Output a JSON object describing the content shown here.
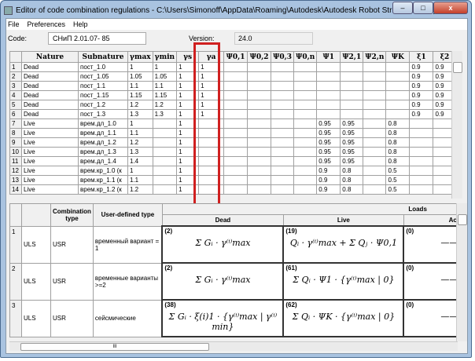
{
  "window": {
    "title": "Editor of code combination regulations - C:\\Users\\Simonoff\\AppData\\Roaming\\Autodesk\\Autodesk Robot Structural Analys...",
    "minimize": "–",
    "maximize": "□",
    "close": "x"
  },
  "menu": [
    "File",
    "Preferences",
    "Help"
  ],
  "code": {
    "label": "Code:",
    "value": "СНиП 2.01.07- 85"
  },
  "version": {
    "label": "Version:",
    "value": "24.0"
  },
  "top_table": {
    "headers": [
      "",
      "Nature",
      "Subnature",
      "γmax",
      "γmin",
      "γs",
      "γa",
      "Ψ0,1",
      "Ψ0,2",
      "Ψ0,3",
      "Ψ0,n",
      "Ψ1",
      "Ψ2,1",
      "Ψ2,n",
      "ΨK",
      "ξ1",
      "ξ2"
    ],
    "rows": [
      [
        "1",
        "Dead",
        "пост_1.0",
        "1",
        "1",
        "1",
        "1",
        "",
        "",
        "",
        "",
        "",
        "",
        "",
        "",
        "0.9",
        "0.9"
      ],
      [
        "2",
        "Dead",
        "пост_1.05",
        "1.05",
        "1.05",
        "1",
        "1",
        "",
        "",
        "",
        "",
        "",
        "",
        "",
        "",
        "0.9",
        "0.9"
      ],
      [
        "3",
        "Dead",
        "пост_1.1",
        "1.1",
        "1.1",
        "1",
        "1",
        "",
        "",
        "",
        "",
        "",
        "",
        "",
        "",
        "0.9",
        "0.9"
      ],
      [
        "4",
        "Dead",
        "пост_1.15",
        "1.15",
        "1.15",
        "1",
        "1",
        "",
        "",
        "",
        "",
        "",
        "",
        "",
        "",
        "0.9",
        "0.9"
      ],
      [
        "5",
        "Dead",
        "пост_1.2",
        "1.2",
        "1.2",
        "1",
        "1",
        "",
        "",
        "",
        "",
        "",
        "",
        "",
        "",
        "0.9",
        "0.9"
      ],
      [
        "6",
        "Dead",
        "пост_1.3",
        "1.3",
        "1.3",
        "1",
        "1",
        "",
        "",
        "",
        "",
        "",
        "",
        "",
        "",
        "0.9",
        "0.9"
      ],
      [
        "7",
        "Live",
        "врем.дл_1.0",
        "1",
        "",
        "1",
        "",
        "",
        "",
        "",
        "",
        "0.95",
        "0.95",
        "",
        "0.8",
        "",
        ""
      ],
      [
        "8",
        "Live",
        "врем.дл_1.1",
        "1.1",
        "",
        "1",
        "",
        "",
        "",
        "",
        "",
        "0.95",
        "0.95",
        "",
        "0.8",
        "",
        ""
      ],
      [
        "9",
        "Live",
        "врем.дл_1.2",
        "1.2",
        "",
        "1",
        "",
        "",
        "",
        "",
        "",
        "0.95",
        "0.95",
        "",
        "0.8",
        "",
        ""
      ],
      [
        "10",
        "Live",
        "врем.дл_1.3",
        "1.3",
        "",
        "1",
        "",
        "",
        "",
        "",
        "",
        "0.95",
        "0.95",
        "",
        "0.8",
        "",
        ""
      ],
      [
        "11",
        "Live",
        "врем.дл_1.4",
        "1.4",
        "",
        "1",
        "",
        "",
        "",
        "",
        "",
        "0.95",
        "0.95",
        "",
        "0.8",
        "",
        ""
      ],
      [
        "12",
        "Live",
        "врем.кр_1.0 (к",
        "1",
        "",
        "1",
        "",
        "",
        "",
        "",
        "",
        "0.9",
        "0.8",
        "",
        "0.5",
        "",
        ""
      ],
      [
        "13",
        "Live",
        "врем.кр_1.1 (к",
        "1.1",
        "",
        "1",
        "",
        "",
        "",
        "",
        "",
        "0.9",
        "0.8",
        "",
        "0.5",
        "",
        ""
      ],
      [
        "14",
        "Live",
        "врем.кр_1.2 (к",
        "1.2",
        "",
        "1",
        "",
        "",
        "",
        "",
        "",
        "0.9",
        "0.8",
        "",
        "0.5",
        "",
        ""
      ]
    ]
  },
  "bottom_table": {
    "loads_label": "Loads",
    "headers": {
      "combination_type": "Combination type",
      "user_defined_type": "User-defined type",
      "dead": "Dead",
      "live": "Live",
      "accidental": "Ac"
    },
    "rows": [
      {
        "num": "1",
        "limit": "ULS",
        "comb": "USR",
        "type": "временный вариант = 1",
        "dead_num": "(2)",
        "dead_eq": "Σ Gᵢ · γ⁽ⁱ⁾max",
        "live_num": "(19)",
        "live_eq": "Qᵢ · γ⁽ⁱ⁾max + Σ Qⱼ · Ψ0,1",
        "acc_num": "(0)",
        "acc_eq": "——"
      },
      {
        "num": "2",
        "limit": "ULS",
        "comb": "USR",
        "type": "временные варианты >=2",
        "dead_num": "(2)",
        "dead_eq": "Σ Gᵢ · γ⁽ⁱ⁾max",
        "live_num": "(61)",
        "live_eq": "Σ Qᵢ · Ψ1 · {γ⁽ⁱ⁾max | 0}",
        "acc_num": "(0)",
        "acc_eq": "——"
      },
      {
        "num": "3",
        "limit": "ULS",
        "comb": "USR",
        "type": "сейсмические",
        "dead_num": "(38)",
        "dead_eq": "Σ Gᵢ · ξ(i)1 · {γ⁽ⁱ⁾max | γ⁽ⁱ⁾min}",
        "live_num": "(62)",
        "live_eq": "Σ Qᵢ · ΨK · {γ⁽ⁱ⁾max | 0}",
        "acc_num": "(0)",
        "acc_eq": "——"
      }
    ]
  },
  "scroll_grip": "III",
  "highlight_color": "#d02020"
}
